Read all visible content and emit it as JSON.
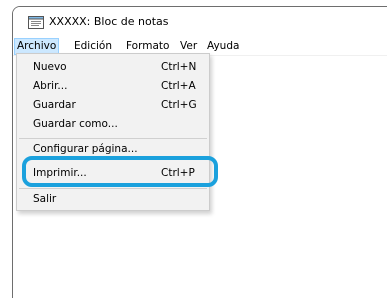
{
  "window": {
    "title": "XXXXX: Bloc de notas",
    "icon": "notepad-icon"
  },
  "menubar": {
    "items": [
      {
        "label": "Archivo",
        "active": true
      },
      {
        "label": "Edición"
      },
      {
        "label": "Formato"
      },
      {
        "label": "Ver"
      },
      {
        "label": "Ayuda"
      }
    ]
  },
  "file_menu": {
    "items": [
      {
        "label": "Nuevo",
        "shortcut": "Ctrl+N"
      },
      {
        "label": "Abrir...",
        "shortcut": "Ctrl+A"
      },
      {
        "label": "Guardar",
        "shortcut": "Ctrl+G"
      },
      {
        "label": "Guardar como...",
        "shortcut": ""
      },
      {
        "label": "Configurar página...",
        "shortcut": ""
      },
      {
        "label": "Imprimir...",
        "shortcut": "Ctrl+P"
      },
      {
        "label": "Salir",
        "shortcut": ""
      }
    ]
  },
  "colors": {
    "highlight_ring": "#1ba1dd",
    "menu_active_bg": "#cce8ff",
    "dropdown_bg": "#f2f2f2"
  }
}
